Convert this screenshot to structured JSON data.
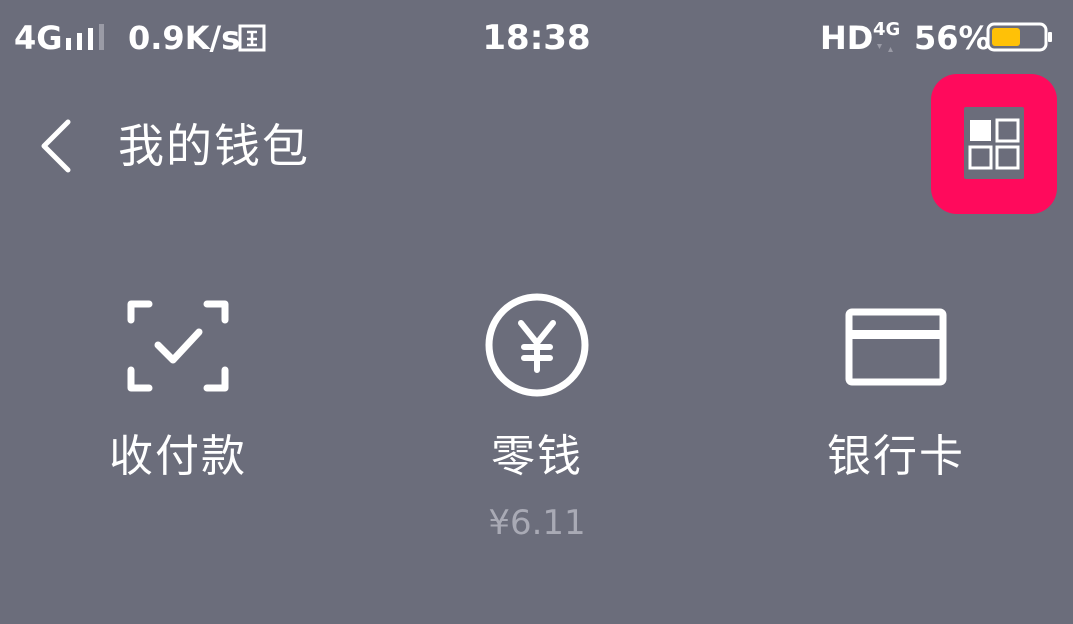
{
  "status_bar": {
    "network": "4G",
    "speed": "0.9K/s",
    "time": "18:38",
    "hd": "HD",
    "lte": "4G",
    "battery_pct": "56%",
    "battery_level": 0.56,
    "battery_color": "#ffc107"
  },
  "header": {
    "title": "我的钱包",
    "menu_highlight_color": "#ff0a5c"
  },
  "actions": [
    {
      "label": "收付款",
      "icon": "scan-check-icon"
    },
    {
      "label": "零钱",
      "sub": "¥6.11",
      "icon": "yen-coin-icon"
    },
    {
      "label": "银行卡",
      "icon": "bank-card-icon"
    }
  ]
}
